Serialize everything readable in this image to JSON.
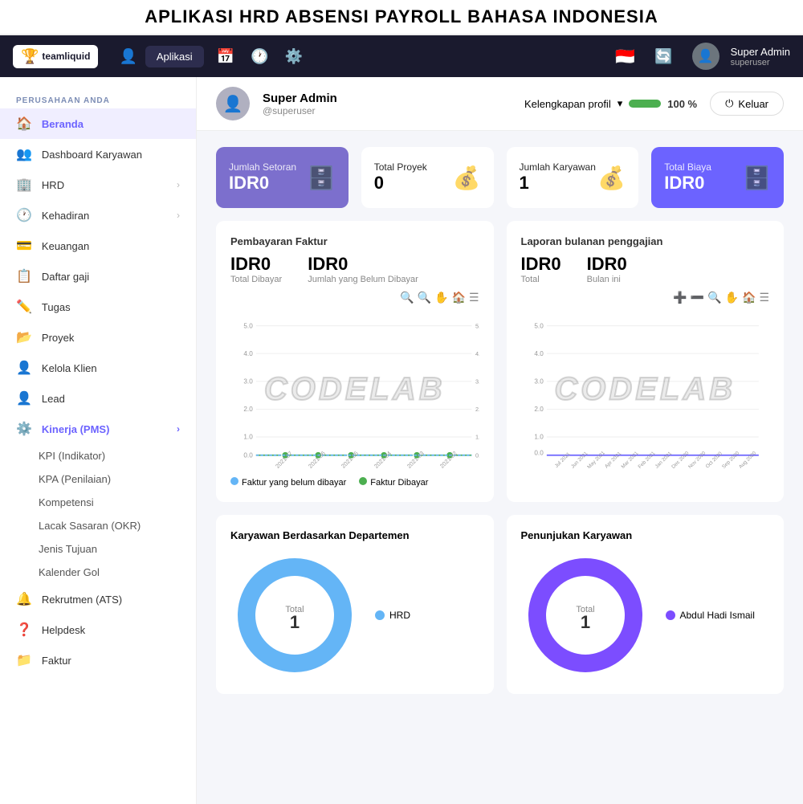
{
  "banner": {
    "title": "APLIKASI HRD ABSENSI PAYROLL BAHASA INDONESIA"
  },
  "navbar": {
    "logo": "teamliquid",
    "logo_icon": "🏆",
    "aplikasi_label": "Aplikasi",
    "user_name": "Super Admin",
    "user_sub": "superuser"
  },
  "sidebar": {
    "section_title": "PERUSAHAAN ANDA",
    "items": [
      {
        "id": "beranda",
        "label": "Beranda",
        "icon": "🏠",
        "active": true
      },
      {
        "id": "dashboard-karyawan",
        "label": "Dashboard Karyawan",
        "icon": "👥",
        "active": false
      },
      {
        "id": "hrd",
        "label": "HRD",
        "icon": "🏢",
        "active": false,
        "has_chevron": true
      },
      {
        "id": "kehadiran",
        "label": "Kehadiran",
        "icon": "🕐",
        "active": false,
        "has_chevron": true
      },
      {
        "id": "keuangan",
        "label": "Keuangan",
        "icon": "💳",
        "active": false
      },
      {
        "id": "daftar-gaji",
        "label": "Daftar gaji",
        "icon": "📋",
        "active": false
      },
      {
        "id": "tugas",
        "label": "Tugas",
        "icon": "✏️",
        "active": false
      },
      {
        "id": "proyek",
        "label": "Proyek",
        "icon": "📂",
        "active": false
      },
      {
        "id": "kelola-klien",
        "label": "Kelola Klien",
        "icon": "👤",
        "active": false
      },
      {
        "id": "lead",
        "label": "Lead",
        "icon": "👤",
        "active": false
      },
      {
        "id": "kinerja",
        "label": "Kinerja (PMS)",
        "icon": "⚙️",
        "active": false,
        "active_kinerja": true,
        "has_chevron": true
      },
      {
        "id": "rekrutmen",
        "label": "Rekrutmen (ATS)",
        "icon": "🔔",
        "active": false
      },
      {
        "id": "helpdesk",
        "label": "Helpdesk",
        "icon": "❓",
        "active": false
      },
      {
        "id": "faktur",
        "label": "Faktur",
        "icon": "📁",
        "active": false
      }
    ],
    "sub_items": [
      "KPI (Indikator)",
      "KPA (Penilaian)",
      "Kompetensi",
      "Lacak Sasaran (OKR)",
      "Jenis Tujuan",
      "Kalender Gol"
    ]
  },
  "profile_header": {
    "name": "Super Admin",
    "username": "@superuser",
    "completion_label": "Kelengkapan profil",
    "completion_pct": "100 %",
    "keluar_label": "Keluar"
  },
  "stats": [
    {
      "id": "jumlah-setoran",
      "label": "Jumlah Setoran",
      "value": "IDR0",
      "style": "purple",
      "icon": "🗄️"
    },
    {
      "id": "total-proyek",
      "label": "Total Proyek",
      "value": "0",
      "style": "white",
      "icon": "💰"
    },
    {
      "id": "jumlah-karyawan",
      "label": "Jumlah Karyawan",
      "value": "1",
      "style": "white",
      "icon": "💰"
    },
    {
      "id": "total-biaya",
      "label": "Total Biaya",
      "value": "IDR0",
      "style": "purple-dark",
      "icon": "🗄️"
    }
  ],
  "pembayaran_faktur": {
    "title": "Pembayaran Faktur",
    "total_dibayar_value": "IDR0",
    "total_dibayar_label": "Total Dibayar",
    "belum_dibayar_value": "IDR0",
    "belum_dibayar_label": "Jumlah yang Belum Dibayar",
    "watermark": "CODELAB",
    "legend_belum": "Faktur yang belum dibayar",
    "legend_dibayar": "Faktur Dibayar",
    "x_labels": [
      "2021.07",
      "2021.06",
      "2021.05",
      "2021.04",
      "2021.03",
      "2021.02"
    ],
    "y_labels": [
      "5.0",
      "4.0",
      "3.0",
      "2.0",
      "1.0",
      "0.0"
    ]
  },
  "laporan_penggajian": {
    "title": "Laporan bulanan penggajian",
    "total_value": "IDR0",
    "total_label": "Total",
    "bulan_ini_value": "IDR0",
    "bulan_ini_label": "Bulan ini",
    "watermark": "CODELAB",
    "x_labels": [
      "Jul 2021",
      "Jun 2021",
      "May 2021",
      "Apr 2021",
      "Mar 2021",
      "Feb 2021",
      "Jan 2021",
      "Dec 2020",
      "Nov 2020",
      "Oct 2020",
      "Sep 2020",
      "Aug 2020"
    ],
    "y_labels": [
      "5.0",
      "4.0",
      "3.0",
      "2.0",
      "1.0",
      "0.0"
    ]
  },
  "karyawan_departemen": {
    "title": "Karyawan Berdasarkan Departemen",
    "total_label": "Total",
    "total_value": "1",
    "legend": [
      {
        "label": "HRD",
        "color": "#64b5f6"
      }
    ]
  },
  "penunjukan_karyawan": {
    "title": "Penunjukan Karyawan",
    "total_label": "Total",
    "total_value": "1",
    "legend": [
      {
        "label": "Abdul Hadi Ismail",
        "color": "#7c4dff"
      }
    ]
  }
}
